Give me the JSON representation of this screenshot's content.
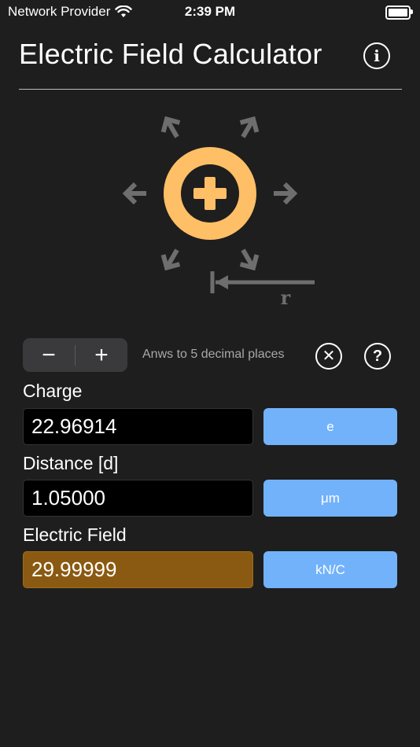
{
  "status_bar": {
    "carrier": "Network Provider",
    "time": "2:39 PM"
  },
  "header": {
    "title": "Electric Field Calculator",
    "info_icon": "info-icon",
    "info_glyph": "i"
  },
  "illustration": {
    "distance_label": "r",
    "charge_color": "#ffbf66",
    "arrow_color": "#6e6e6e"
  },
  "controls": {
    "decrement_label": "−",
    "increment_label": "+",
    "decimals_text": "Anws to 5 decimal places",
    "clear_glyph": "✕",
    "help_glyph": "?"
  },
  "fields": {
    "charge": {
      "label": "Charge",
      "value": "22.96914",
      "unit": "e"
    },
    "distance": {
      "label": "Distance [d]",
      "value": "1.05000",
      "unit": "μm"
    },
    "electric_field": {
      "label": "Electric Field",
      "value": "29.99999",
      "unit": "kN/C"
    }
  },
  "colors": {
    "background": "#1e1e1e",
    "unit_button": "#72b2fb",
    "result_field": "#8a5a12"
  }
}
